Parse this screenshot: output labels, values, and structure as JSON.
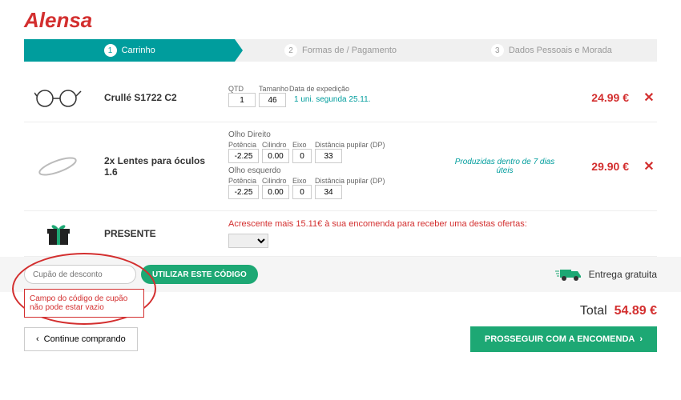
{
  "brand": "Alensa",
  "steps": [
    {
      "num": "1",
      "label": "Carrinho"
    },
    {
      "num": "2",
      "label": "Formas de / Pagamento"
    },
    {
      "num": "3",
      "label": "Dados Pessoais e Morada"
    }
  ],
  "items": [
    {
      "name": "Crullé S1722 C2",
      "qtd_label": "QTD",
      "size_label": "Tamanho",
      "ship_label": "Data de expedição",
      "qtd": "1",
      "size": "46",
      "ship": "1 uni. segunda 25.11.",
      "price": "24.99 €"
    },
    {
      "name": "2x Lentes para óculos 1.6",
      "right_label": "Olho Direito",
      "left_label": "Olho esquerdo",
      "pot_label": "Potência",
      "cil_label": "Cilindro",
      "eixo_label": "Eixo",
      "dp_label": "Distância pupilar (DP)",
      "r_pot": "-2.25",
      "r_cil": "0.00",
      "r_eixo": "0",
      "r_dp": "33",
      "l_pot": "-2.25",
      "l_cil": "0.00",
      "l_eixo": "0",
      "l_dp": "34",
      "ship_note": "Produzidas dentro de 7 dias úteis",
      "price": "29.90 €"
    }
  ],
  "gift": {
    "title": "PRESENTE",
    "msg": "Acrescente mais 15.11€ à sua encomenda para receber uma destas ofertas:"
  },
  "coupon": {
    "placeholder": "Cupão de desconto",
    "btn": "UTILIZAR ESTE CÓDIGO",
    "error": "Campo do código de cupão não pode estar vazio"
  },
  "free_ship": "Entrega gratuita",
  "total_label": "Total",
  "total_value": "54.89 €",
  "back_btn": "Continue comprando",
  "proceed_btn": "PROSSEGUIR COM A ENCOMENDA"
}
